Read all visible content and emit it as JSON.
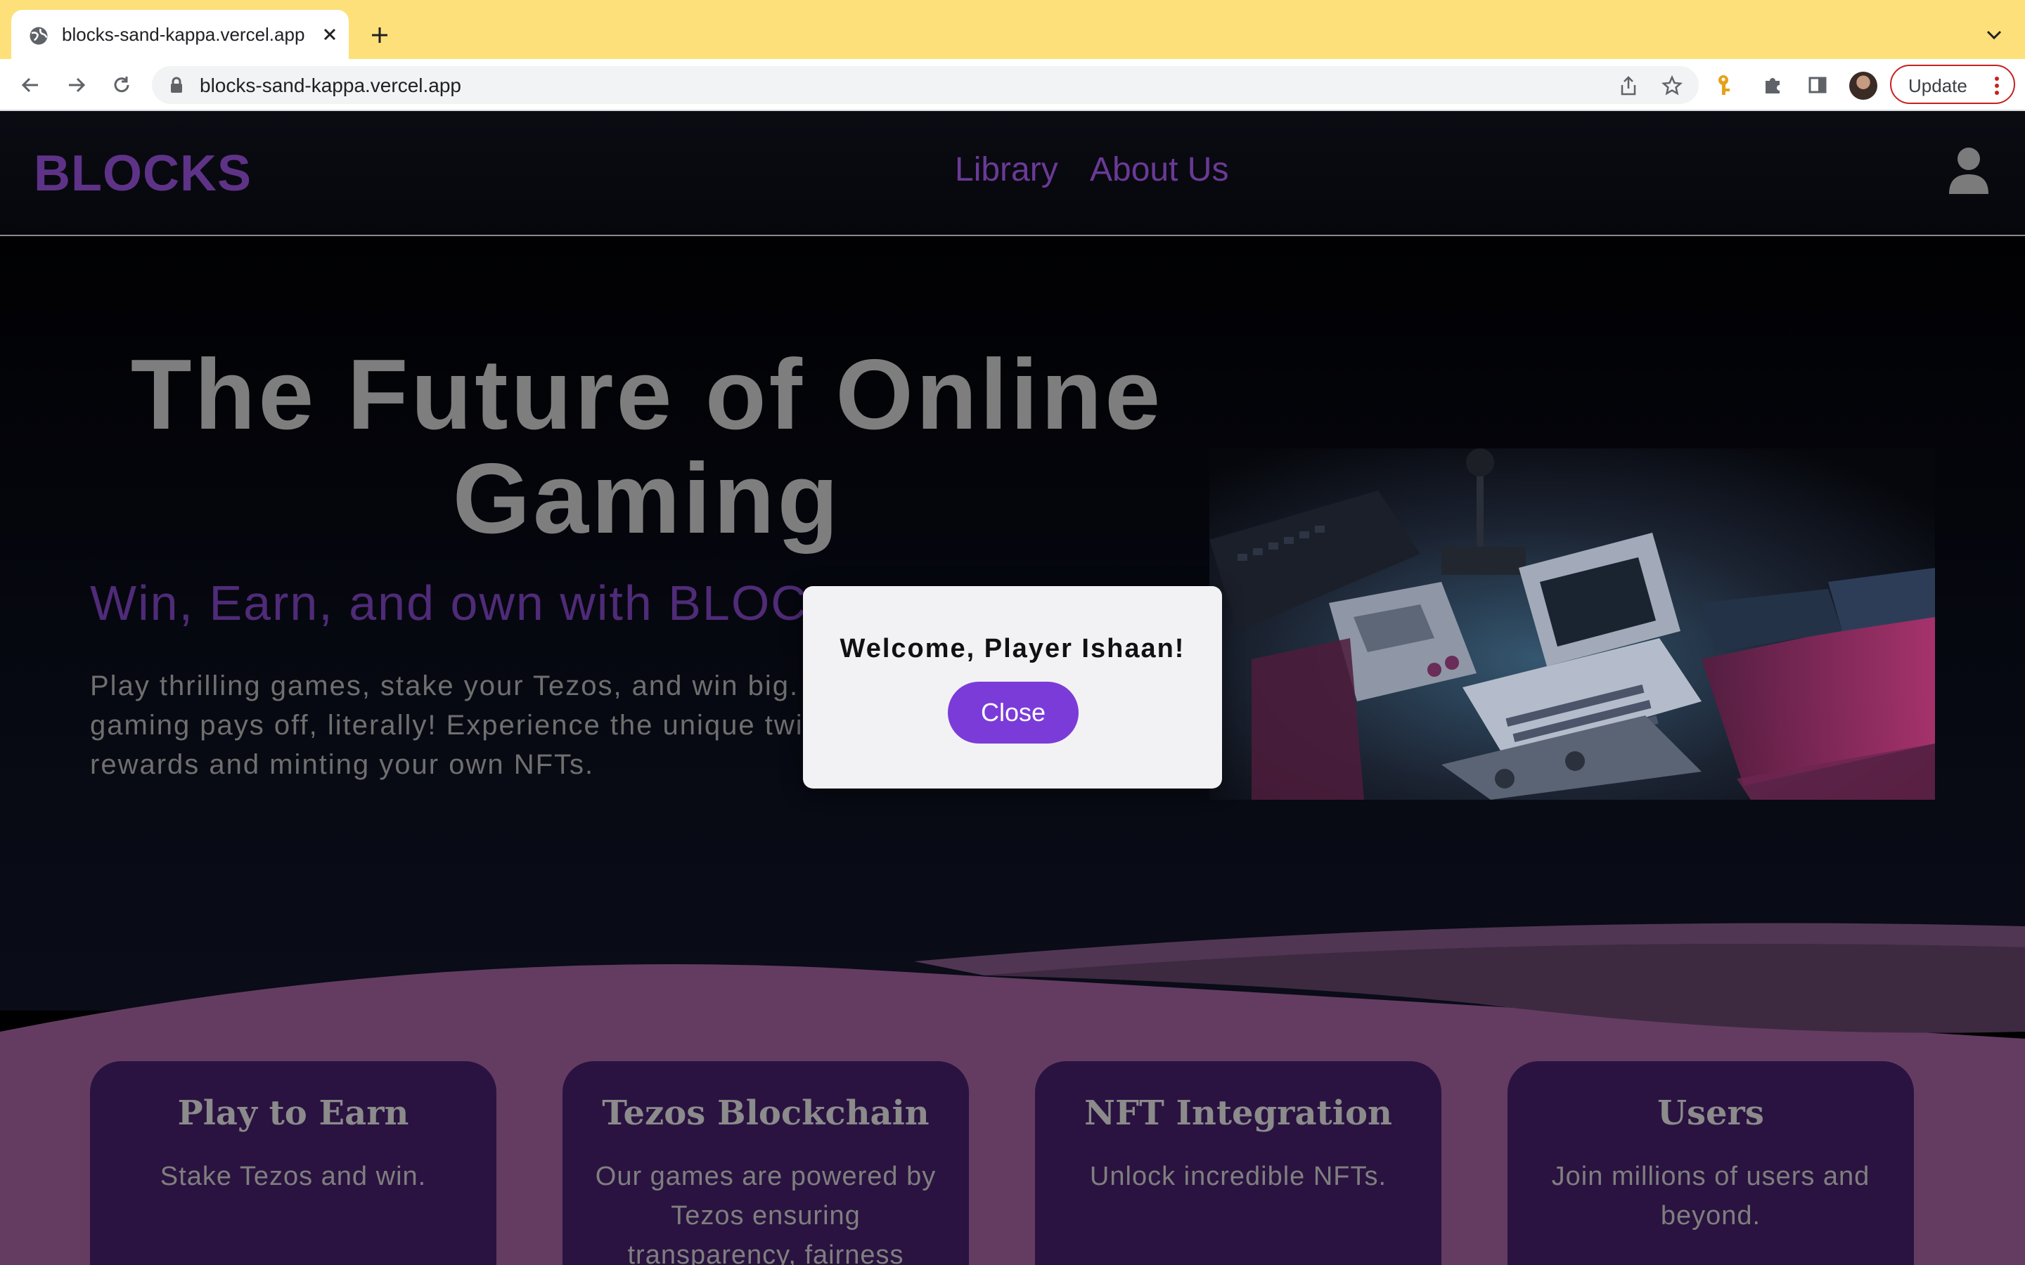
{
  "browser": {
    "tab_title": "blocks-sand-kappa.vercel.app",
    "url": "blocks-sand-kappa.vercel.app",
    "update_label": "Update",
    "accent_tabstrip": "#fde079"
  },
  "site": {
    "brand": "BLOCKS",
    "nav": [
      {
        "label": "Library"
      },
      {
        "label": "About Us"
      }
    ],
    "hero": {
      "title_line1": "The Future of Online",
      "title_line2": "Gaming",
      "subtitle": "Win, Earn, and own with BLOC",
      "body": "Play thrilling games, stake your Tezos, and win big. gaming pays off, literally! Experience the unique twi rewards and minting your own NFTs."
    },
    "cards": [
      {
        "title": "Play to Earn",
        "text": "Stake Tezos and win."
      },
      {
        "title": "Tezos Blockchain",
        "text": "Our games are powered by Tezos ensuring transparency, fairness"
      },
      {
        "title": "NFT Integration",
        "text": "Unlock incredible NFTs."
      },
      {
        "title": "Users",
        "text": "Join millions of users and beyond."
      }
    ],
    "colors": {
      "brand": "#5e3387",
      "card_bg": "#2a1340",
      "wave": "#643c61",
      "close_button": "#7b3bd9"
    }
  },
  "modal": {
    "title": "Welcome, Player Ishaan!",
    "close_label": "Close"
  }
}
